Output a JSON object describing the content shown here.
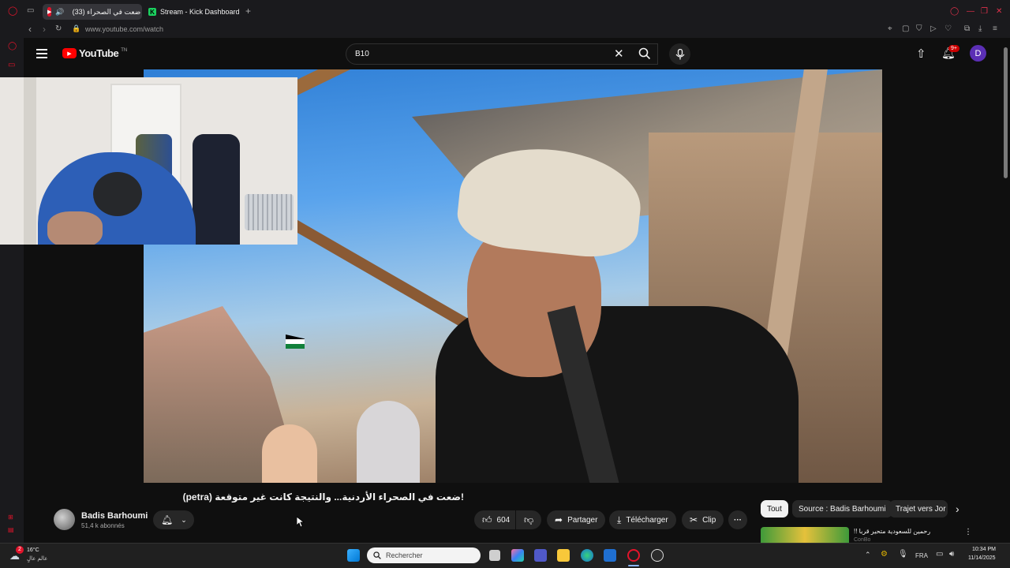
{
  "browser": {
    "tabs": [
      {
        "label": "(33) ضعت في الصحراء",
        "active": true,
        "badge_color": "#e3142b"
      },
      {
        "label": "Stream - Kick Dashboard",
        "active": false,
        "badge_color": "#1bd05f"
      }
    ],
    "new_tab_symbol": "+",
    "url": "www.youtube.com/watch"
  },
  "youtube": {
    "logo_text": "YouTube",
    "logo_suffix": "TN",
    "search_query": "B10",
    "notifications_badge": "9+",
    "avatar_letter": "D",
    "video": {
      "title": "(petra) ضعت في الصحراء الأردنية... والنتيجة كانت غير متوقعة!",
      "channel_name": "Badis Barhoumi",
      "subscribers": "51,4 k abonnés",
      "likes": "604",
      "share_label": "Partager",
      "download_label": "Télécharger",
      "clip_label": "Clip",
      "more_label": "···"
    },
    "chips": [
      {
        "label": "Tout",
        "active": true
      },
      {
        "label": "Source : Badis Barhoumi",
        "active": false
      },
      {
        "label": "Trajet vers Jor",
        "active": false
      }
    ],
    "suggestion": {
      "title": "رحمين للسعودية متحير قربا !!",
      "channel": "ConBo"
    }
  },
  "taskbar": {
    "weather_temp": "16°C",
    "weather_desc": "عالم عالٍ",
    "weather_badge": "2",
    "search_placeholder": "Rechercher",
    "language": "FRA",
    "time": "10:34 PM",
    "date": "11/14/2025"
  },
  "colors": {
    "yt_red": "#ff0000",
    "opera_red": "#e3142b",
    "avatar_bg": "#5b2fb5",
    "notif_badge": "#cc0000"
  }
}
